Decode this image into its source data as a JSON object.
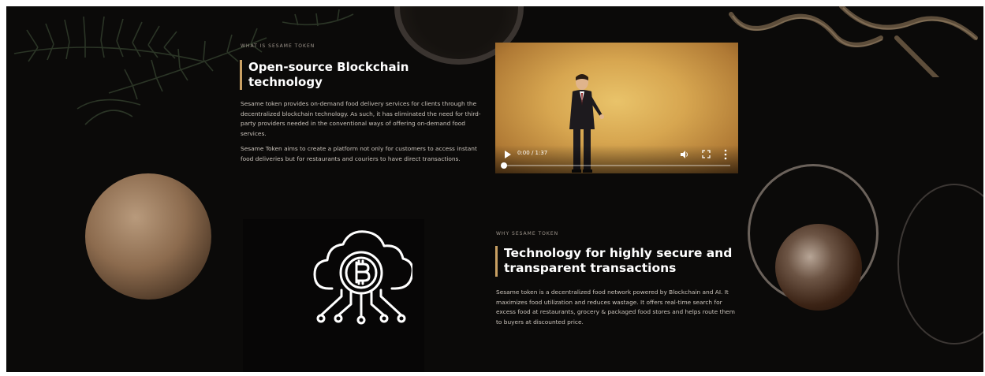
{
  "section1": {
    "eyebrow": "WHAT IS SESAME TOKEN",
    "title_line1": "Open-source Blockchain",
    "title_line2": "technology",
    "paragraph1": "Sesame token provides on-demand food delivery services for clients through the decentralized blockchain technology. As such, it has eliminated the need for third-party providers needed in the conventional ways of offering on-demand food services.",
    "paragraph2": "Sesame Token aims to create a platform not only for customers to access instant food deliveries but for restaurants and couriers to have direct transactions."
  },
  "video": {
    "time": "0:00 / 1:37",
    "progress": 0,
    "controls": [
      "play-icon",
      "volume-icon",
      "fullscreen-icon",
      "more-options-icon"
    ]
  },
  "icon": {
    "name": "bitcoin-cloud-icon"
  },
  "section2": {
    "eyebrow": "WHY SESAME TOKEN",
    "title_line1": "Technology for highly secure and",
    "title_line2": "transparent transactions",
    "paragraph": "Sesame token is a decentralized food network powered by Blockchain and AI. It maximizes food utilization and reduces wastage. It offers real-time search for excess food at restaurants, grocery & packaged food stores and helps route them to buyers at discounted price."
  },
  "colors": {
    "background": "#0b0a09",
    "accent": "#c9a063",
    "text": "#ffffff",
    "body_text": "#cbc4bc"
  }
}
